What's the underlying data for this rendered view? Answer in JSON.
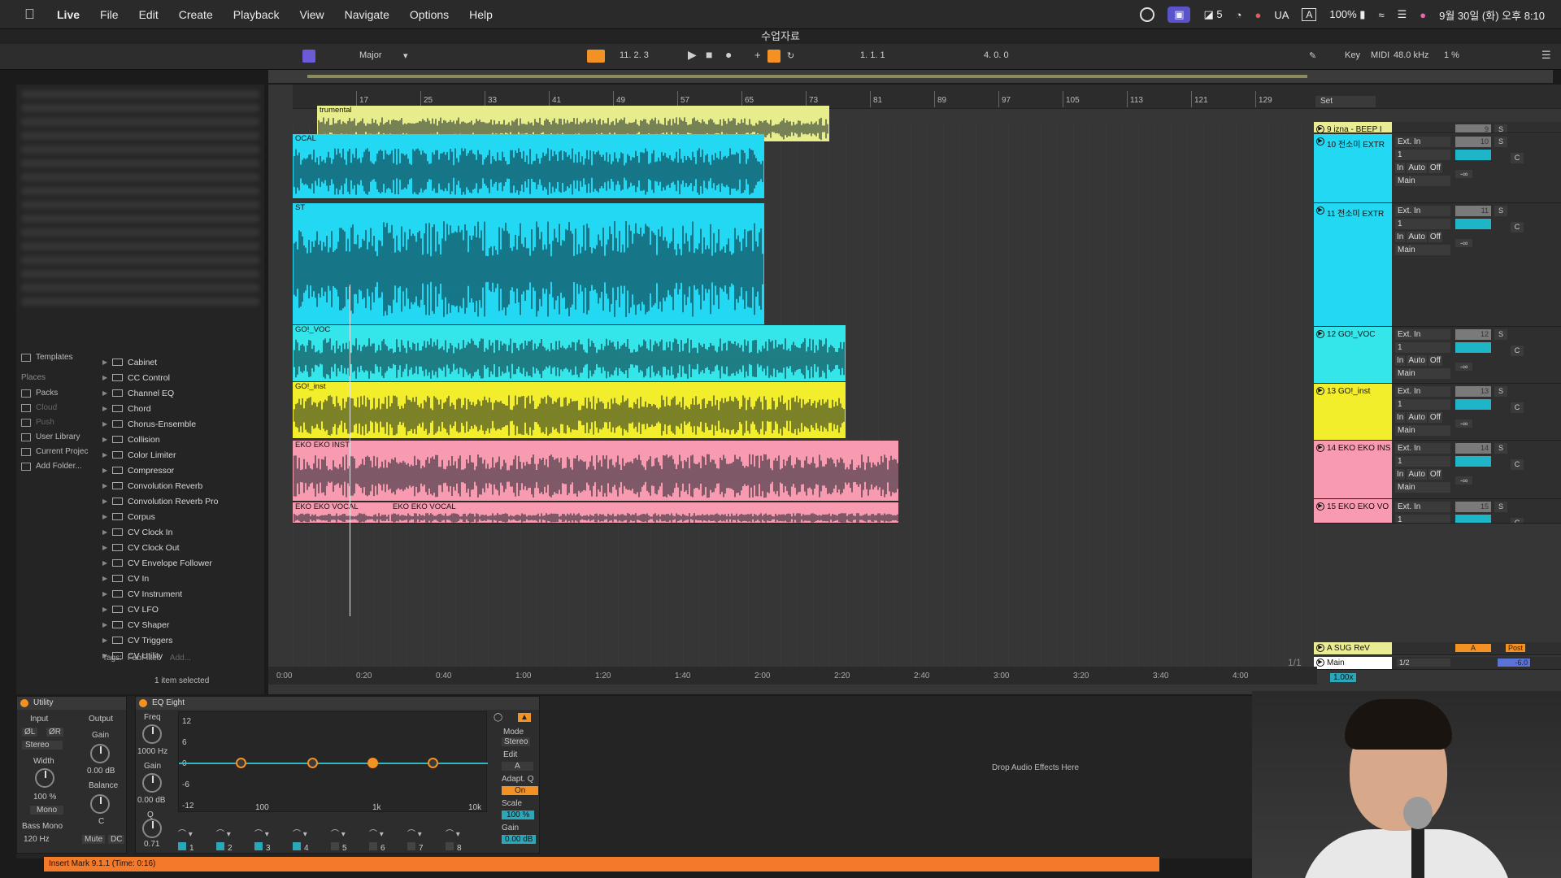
{
  "menubar": {
    "app": "Live",
    "items": [
      "File",
      "Edit",
      "Create",
      "Playback",
      "View",
      "Navigate",
      "Options",
      "Help"
    ],
    "status_5": "5",
    "input": "UA",
    "input_box": "A",
    "battery": "100%",
    "datetime": "9월 30일 (화) 오후 8:10"
  },
  "window": {
    "title": "수업자료"
  },
  "transport": {
    "scale": "Major",
    "position": "11.  2.  3",
    "loop_start": "1.  1.  1",
    "loop_len": "4.  0.  0",
    "key": "Key",
    "midi": "MIDI",
    "sample_rate": "48.0 kHz",
    "cpu": "1 %"
  },
  "ruler": [
    "17",
    "25",
    "33",
    "41",
    "49",
    "57",
    "65",
    "73",
    "81",
    "89",
    "97",
    "105",
    "113",
    "121",
    "129"
  ],
  "set_label": "Set",
  "time_ruler": [
    "0:00",
    "0:20",
    "0:40",
    "1:00",
    "1:20",
    "1:40",
    "2:00",
    "2:20",
    "2:40",
    "3:00",
    "3:20",
    "3:40",
    "4:00"
  ],
  "browser": {
    "places_header": "Places",
    "templates": "Templates",
    "places": [
      "Packs",
      "Cloud",
      "Push",
      "User Library",
      "Current Projec",
      "Add Folder..."
    ],
    "devices": [
      "Cabinet",
      "CC Control",
      "Channel EQ",
      "Chord",
      "Chorus-Ensemble",
      "Collision",
      "Color Limiter",
      "Compressor",
      "Convolution Reverb",
      "Convolution Reverb Pro",
      "Corpus",
      "CV Clock In",
      "CV Clock Out",
      "CV Envelope Follower",
      "CV In",
      "CV Instrument",
      "CV LFO",
      "CV Shaper",
      "CV Triggers",
      "CV Utility"
    ],
    "tags_label": "Tags:",
    "tag": "FabFilter",
    "tag_add": "Add...",
    "selection": "1 item selected"
  },
  "clips": [
    {
      "name": "trumental",
      "color": "#e8ed8c"
    },
    {
      "name": "OCAL",
      "color": "#22d8f2"
    },
    {
      "name": "ST",
      "color": "#22d8f2"
    },
    {
      "name": "GO!_VOC",
      "color": "#34e6ea"
    },
    {
      "name": "GO!_inst",
      "color": "#f2ee2c"
    },
    {
      "name": "EKO EKO INST",
      "color": "#f99bb0"
    },
    {
      "name": "EKO EKO VOCAL",
      "color": "#f99bb0"
    },
    {
      "name": "EKO EKO VOCAL",
      "color": "#f99bb0"
    }
  ],
  "tracks": [
    {
      "name": "9 izna - BEEP I",
      "color": "#e9ec92",
      "num": "9"
    },
    {
      "name": "10 전소미 EXTR",
      "color": "#22d8f2",
      "num": "10",
      "in": "Ext. In",
      "ch": "1",
      "out": "Main"
    },
    {
      "name": "11 전소미 EXTR",
      "color": "#22d8f2",
      "num": "11",
      "in": "Ext. In",
      "ch": "1",
      "out": "Main"
    },
    {
      "name": "12 GO!_VOC",
      "color": "#34e6ea",
      "num": "12",
      "in": "Ext. In",
      "ch": "1",
      "out": "Main"
    },
    {
      "name": "13 GO!_inst",
      "color": "#f2ee2c",
      "num": "13",
      "in": "Ext. In",
      "ch": "1",
      "out": "Main"
    },
    {
      "name": "14 EKO EKO INS",
      "color": "#f99bb0",
      "num": "14",
      "in": "Ext. In",
      "ch": "1",
      "out": "Main"
    },
    {
      "name": "15 EKO EKO VO",
      "color": "#f99bb0",
      "num": "15",
      "in": "Ext. In",
      "ch": "1",
      "out": ""
    }
  ],
  "return_track": {
    "name": "A SUG ReV",
    "send": "A",
    "post": "Post"
  },
  "main_track": {
    "name": "Main",
    "value": "1/2",
    "vol": "-6.0",
    "page": "1/1",
    "zoom": "1.00x"
  },
  "mixer": {
    "solo": "S",
    "center": "C",
    "auto": "Auto",
    "off": "Off",
    "in": "In",
    "neg_inf": "-∞"
  },
  "utility": {
    "title": "Utility",
    "input": "Input",
    "output": "Output",
    "phase_l": "ØL",
    "phase_r": "ØR",
    "gain": "Gain",
    "gain_val": "0.00 dB",
    "stereo": "Stereo",
    "width": "Width",
    "width_val": "100 %",
    "mono": "Mono",
    "balance": "Balance",
    "balance_val": "C",
    "bass_mono": "Bass Mono",
    "bass_freq": "120 Hz",
    "mute": "Mute",
    "dc": "DC"
  },
  "eq": {
    "title": "EQ Eight",
    "freq": "Freq",
    "freq_val": "1000 Hz",
    "gain": "Gain",
    "gain_val": "0.00 dB",
    "q": "Q",
    "q_val": "0.71",
    "db_ticks": [
      "12",
      "6",
      "0",
      "-6",
      "-12"
    ],
    "freq_ticks": [
      "100",
      "1k",
      "10k"
    ],
    "bands": [
      "1",
      "2",
      "3",
      "4",
      "5",
      "6",
      "7",
      "8"
    ],
    "mode": "Mode",
    "mode_val": "Stereo",
    "edit": "Edit",
    "edit_val": "A",
    "adapt": "Adapt. Q",
    "adapt_val": "On",
    "scale": "Scale",
    "scale_val": "100 %",
    "out_gain": "Gain",
    "out_gain_val": "0.00 dB"
  },
  "dropzone": "Drop Audio Effects Here",
  "statusbar": "Insert Mark 9.1.1 (Time: 0:16)"
}
